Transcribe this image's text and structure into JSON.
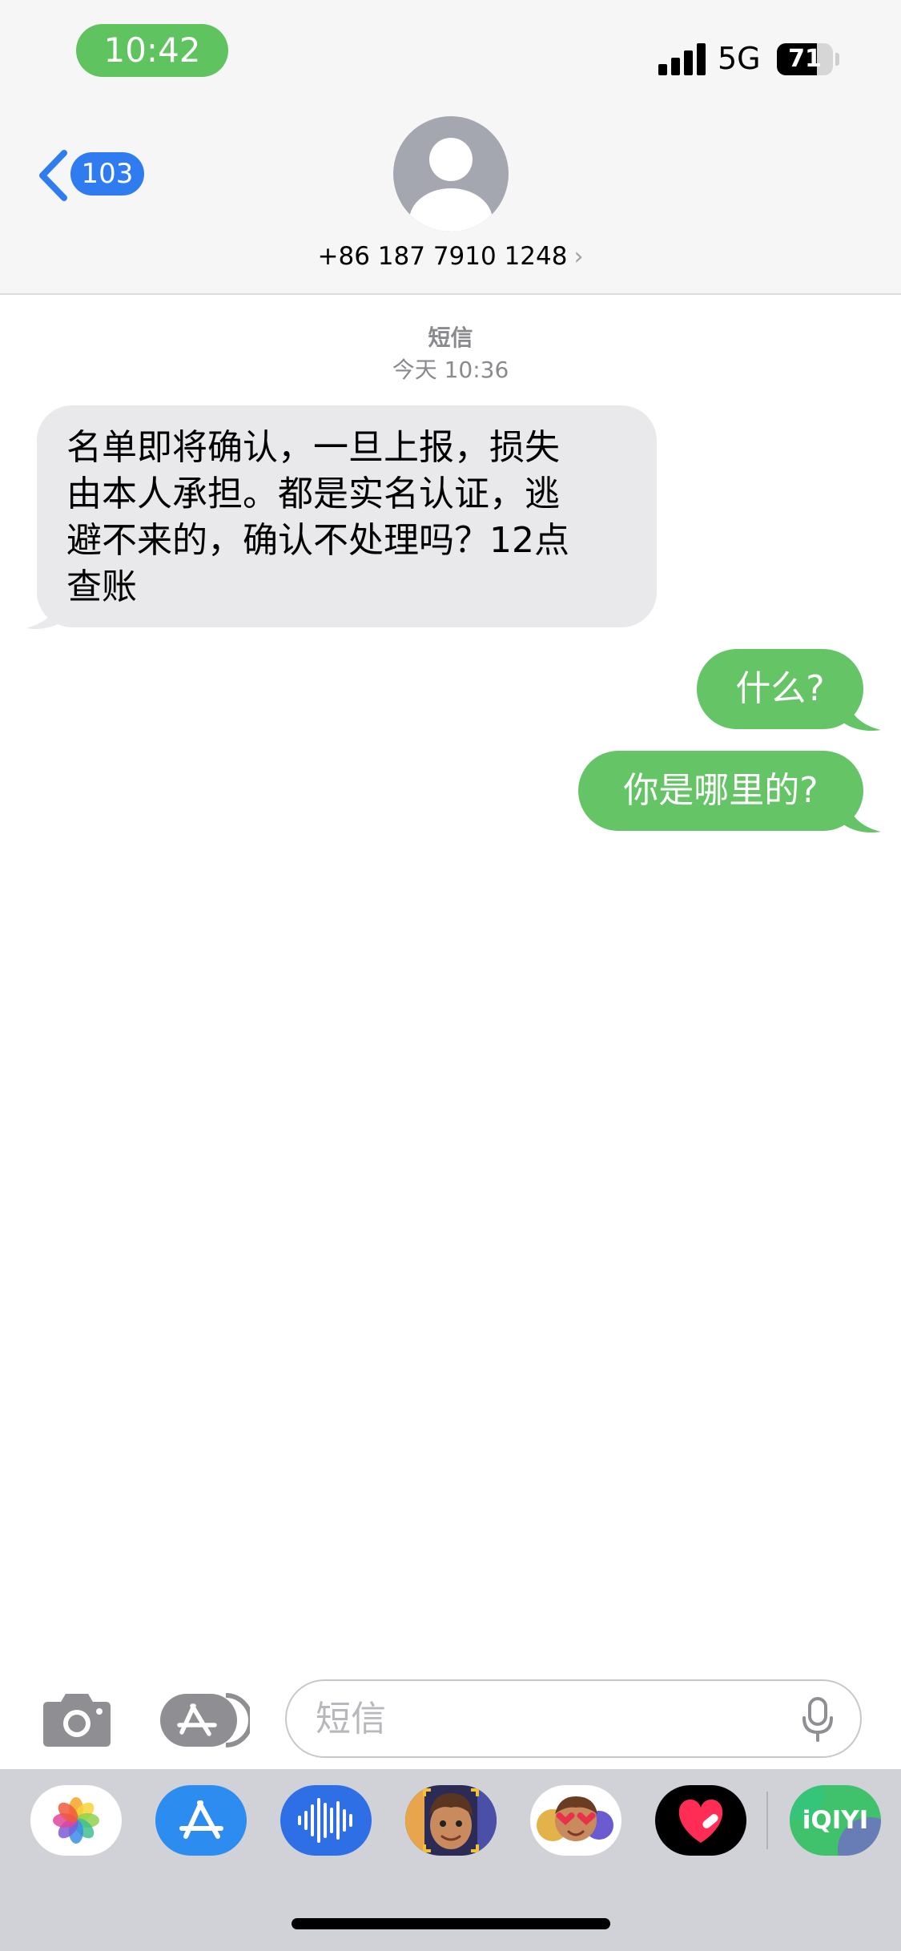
{
  "status_bar": {
    "time": "10:42",
    "network": "5G",
    "battery_level": "71",
    "battery_fraction": 0.71,
    "time_pill_color": "#5fc35f"
  },
  "header": {
    "back_count": "103",
    "contact_number": "+86 187 7910 1248",
    "contact_chevron": "›",
    "back_icon": "chevron-left-icon",
    "avatar_icon": "person-silhouette-icon",
    "accent_color": "#2f7bf0"
  },
  "conversation": {
    "service_label": "短信",
    "timestamp": "今天 10:36",
    "incoming": [
      {
        "lines": [
          "名单即将确认，一旦上报，损失",
          "由本人承担。都是实名认证，逃",
          "避不来的，确认不处理吗？12点",
          "查账"
        ]
      }
    ],
    "outgoing": [
      {
        "text": "什么?"
      },
      {
        "text": "你是哪里的?"
      }
    ],
    "incoming_bubble_color": "#e9e9eb",
    "outgoing_bubble_color": "#65c466"
  },
  "input_bar": {
    "placeholder": "短信",
    "value": "",
    "camera_icon": "camera-icon",
    "apps_icon": "app-store-icon",
    "mic_icon": "microphone-icon"
  },
  "app_drawer": {
    "apps": [
      {
        "name": "photos-app",
        "icon": "photos-flower-icon"
      },
      {
        "name": "app-store-app",
        "icon": "app-store-icon"
      },
      {
        "name": "audio-app",
        "icon": "audio-waveform-icon"
      },
      {
        "name": "memoji-app",
        "icon": "memoji-face-icon"
      },
      {
        "name": "memoji-stickers-app",
        "icon": "memoji-stickers-icon"
      },
      {
        "name": "digital-touch-app",
        "icon": "heart-icon"
      },
      {
        "name": "iqiyi-app",
        "icon": "iqiyi-logo-icon",
        "label": "iQIYI"
      }
    ]
  }
}
